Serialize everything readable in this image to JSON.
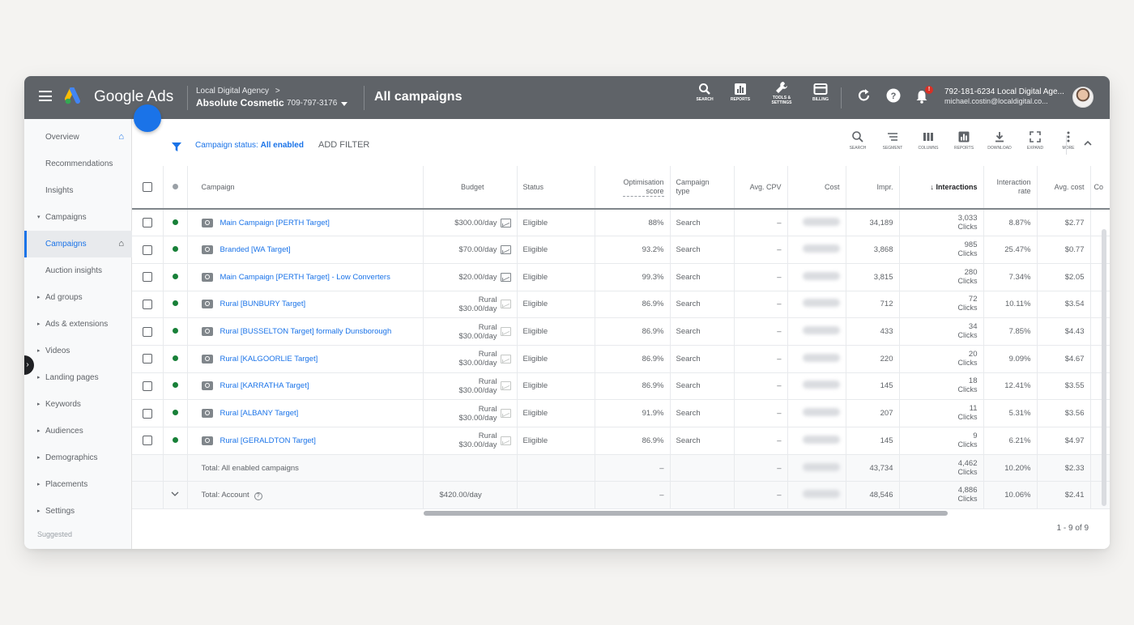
{
  "topbar": {
    "brand": "Google Ads",
    "account_parent": "Local Digital Agency",
    "account_parent_chevron": ">",
    "account_name": "Absolute Cosmetic",
    "account_phone": "709-797-3176",
    "page_title": "All campaigns",
    "tools": [
      {
        "icon": "search-icon",
        "label": "SEARCH"
      },
      {
        "icon": "reports-icon",
        "label": "REPORTS"
      },
      {
        "icon": "wrench-icon",
        "label": "TOOLS & SETTINGS"
      },
      {
        "icon": "billing-icon",
        "label": "BILLING"
      }
    ],
    "notification_badge": "!",
    "user_line1": "792-181-6234 Local Digital Age...",
    "user_line2": "michael.costin@localdigital.co..."
  },
  "sidebar": {
    "items": [
      {
        "label": "Overview",
        "home": true
      },
      {
        "label": "Recommendations"
      },
      {
        "label": "Insights"
      },
      {
        "label": "Campaigns",
        "caret": "▾"
      },
      {
        "label": "Campaigns",
        "active": true,
        "home": true
      },
      {
        "label": "Auction insights"
      },
      {
        "label": "Ad groups",
        "caret": "▸"
      },
      {
        "label": "Ads & extensions",
        "caret": "▸"
      },
      {
        "label": "Videos",
        "caret": "▸"
      },
      {
        "label": "Landing pages",
        "caret": "▸"
      },
      {
        "label": "Keywords",
        "caret": "▸"
      },
      {
        "label": "Audiences",
        "caret": "▸"
      },
      {
        "label": "Demographics",
        "caret": "▸"
      },
      {
        "label": "Placements",
        "caret": "▸"
      },
      {
        "label": "Settings",
        "caret": "▸"
      }
    ],
    "suggested": "Suggested"
  },
  "filterbar": {
    "status_prefix": "Campaign status: ",
    "status_value": "All enabled",
    "add_filter": "ADD FILTER",
    "tools": [
      "SEARCH",
      "SEGMENT",
      "COLUMNS",
      "REPORTS",
      "DOWNLOAD",
      "EXPAND",
      "MORE"
    ]
  },
  "table": {
    "headers": {
      "campaign": "Campaign",
      "budget": "Budget",
      "status": "Status",
      "opt_score_1": "Optimisation",
      "opt_score_2": "score",
      "campaign_type_1": "Campaign",
      "campaign_type_2": "type",
      "avg_cpv": "Avg. CPV",
      "cost": "Cost",
      "impr": "Impr.",
      "interactions": "Interactions",
      "interaction_rate_1": "Interaction",
      "interaction_rate_2": "rate",
      "avg_cost": "Avg. cost",
      "conv": "Co"
    },
    "rows": [
      {
        "campaign": "Main Campaign [PERTH Target]",
        "budget_top": "",
        "budget": "$300.00/day",
        "status": "Eligible",
        "score": "88%",
        "type": "Search",
        "cpv": "–",
        "impr": "34,189",
        "interactions": "3,033",
        "interactions_unit": "Clicks",
        "rate": "8.87%",
        "avg_cost": "$2.77"
      },
      {
        "campaign": "Branded [WA Target]",
        "budget_top": "",
        "budget": "$70.00/day",
        "status": "Eligible",
        "score": "93.2%",
        "type": "Search",
        "cpv": "–",
        "impr": "3,868",
        "interactions": "985",
        "interactions_unit": "Clicks",
        "rate": "25.47%",
        "avg_cost": "$0.77"
      },
      {
        "campaign": "Main Campaign [PERTH Target] - Low Converters",
        "budget_top": "",
        "budget": "$20.00/day",
        "status": "Eligible",
        "score": "99.3%",
        "type": "Search",
        "cpv": "–",
        "impr": "3,815",
        "interactions": "280",
        "interactions_unit": "Clicks",
        "rate": "7.34%",
        "avg_cost": "$2.05"
      },
      {
        "campaign": "Rural [BUNBURY Target]",
        "budget_top": "Rural",
        "budget": "$30.00/day",
        "status": "Eligible",
        "score": "86.9%",
        "type": "Search",
        "cpv": "–",
        "impr": "712",
        "interactions": "72",
        "interactions_unit": "Clicks",
        "rate": "10.11%",
        "avg_cost": "$3.54"
      },
      {
        "campaign": "Rural [BUSSELTON Target] formally Dunsborough",
        "budget_top": "Rural",
        "budget": "$30.00/day",
        "status": "Eligible",
        "score": "86.9%",
        "type": "Search",
        "cpv": "–",
        "impr": "433",
        "interactions": "34",
        "interactions_unit": "Clicks",
        "rate": "7.85%",
        "avg_cost": "$4.43"
      },
      {
        "campaign": "Rural [KALGOORLIE Target]",
        "budget_top": "Rural",
        "budget": "$30.00/day",
        "status": "Eligible",
        "score": "86.9%",
        "type": "Search",
        "cpv": "–",
        "impr": "220",
        "interactions": "20",
        "interactions_unit": "Clicks",
        "rate": "9.09%",
        "avg_cost": "$4.67"
      },
      {
        "campaign": "Rural [KARRATHA Target]",
        "budget_top": "Rural",
        "budget": "$30.00/day",
        "status": "Eligible",
        "score": "86.9%",
        "type": "Search",
        "cpv": "–",
        "impr": "145",
        "interactions": "18",
        "interactions_unit": "Clicks",
        "rate": "12.41%",
        "avg_cost": "$3.55"
      },
      {
        "campaign": "Rural [ALBANY Target]",
        "budget_top": "Rural",
        "budget": "$30.00/day",
        "status": "Eligible",
        "score": "91.9%",
        "type": "Search",
        "cpv": "–",
        "impr": "207",
        "interactions": "11",
        "interactions_unit": "Clicks",
        "rate": "5.31%",
        "avg_cost": "$3.56"
      },
      {
        "campaign": "Rural [GERALDTON Target]",
        "budget_top": "Rural",
        "budget": "$30.00/day",
        "status": "Eligible",
        "score": "86.9%",
        "type": "Search",
        "cpv": "–",
        "impr": "145",
        "interactions": "9",
        "interactions_unit": "Clicks",
        "rate": "6.21%",
        "avg_cost": "$4.97"
      }
    ],
    "total_enabled": {
      "label": "Total: All enabled campaigns",
      "budget": "",
      "score": "–",
      "cpv": "–",
      "impr": "43,734",
      "interactions": "4,462",
      "interactions_unit": "Clicks",
      "rate": "10.20%",
      "avg_cost": "$2.33"
    },
    "total_account": {
      "label": "Total: Account",
      "budget": "$420.00/day",
      "score": "–",
      "cpv": "–",
      "impr": "48,546",
      "interactions": "4,886",
      "interactions_unit": "Clicks",
      "rate": "10.06%",
      "avg_cost": "$2.41"
    }
  },
  "pager": "1 - 9 of 9"
}
